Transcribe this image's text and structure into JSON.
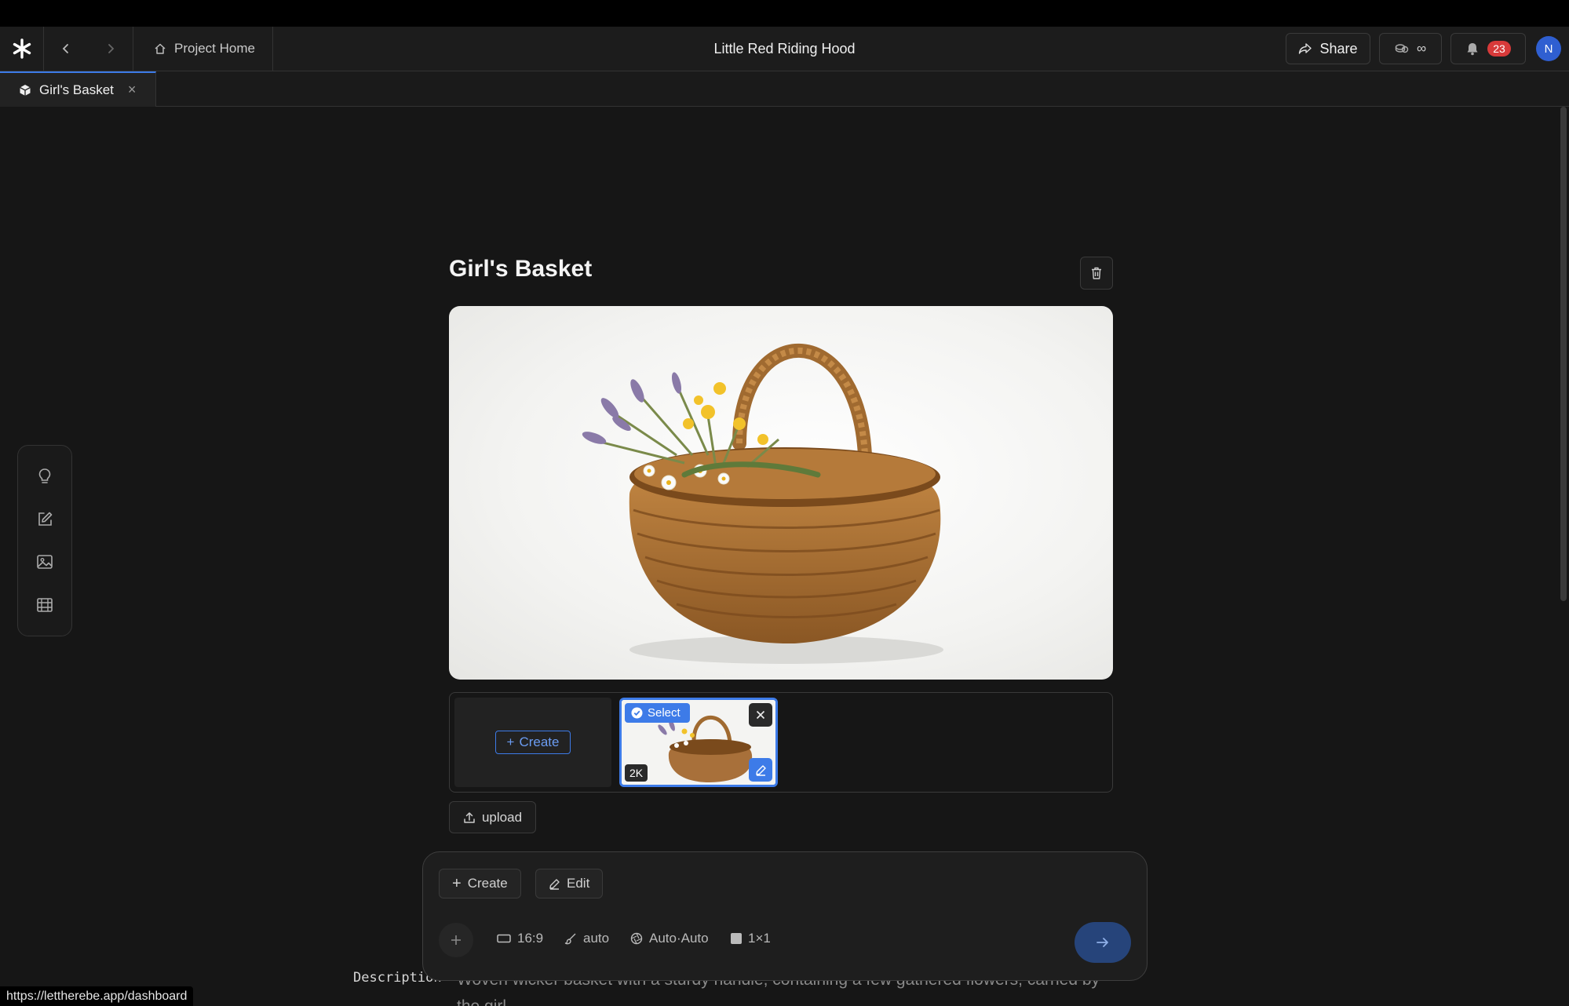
{
  "header": {
    "back_label": "",
    "home_label": "Project Home",
    "project_title": "Little Red Riding Hood",
    "share_label": "Share",
    "credits_value": "∞",
    "notification_count": "23",
    "avatar_initial": "N"
  },
  "tabs": [
    {
      "label": "Girl's Basket",
      "active": true
    }
  ],
  "toolrail": [
    "idea-icon",
    "edit-icon",
    "image-icon",
    "film-icon"
  ],
  "asset": {
    "title": "Girl's Basket",
    "variants": {
      "create_label": "Create",
      "select_label": "Select",
      "resolution_badge": "2K"
    },
    "upload_label": "upload"
  },
  "description": {
    "label": "Description",
    "text": "Woven wicker basket with a sturdy handle, containing a few gathered flowers, carried by the girl"
  },
  "composer": {
    "create_label": "Create",
    "edit_label": "Edit",
    "aspect_ratio": "16:9",
    "style": "auto",
    "model": "Auto·Auto",
    "count": "1×1"
  },
  "status_url": "https://lettherebe.app/dashboard",
  "colors": {
    "accent": "#3d7be8",
    "badge": "#d83a3a",
    "background": "#161616"
  }
}
